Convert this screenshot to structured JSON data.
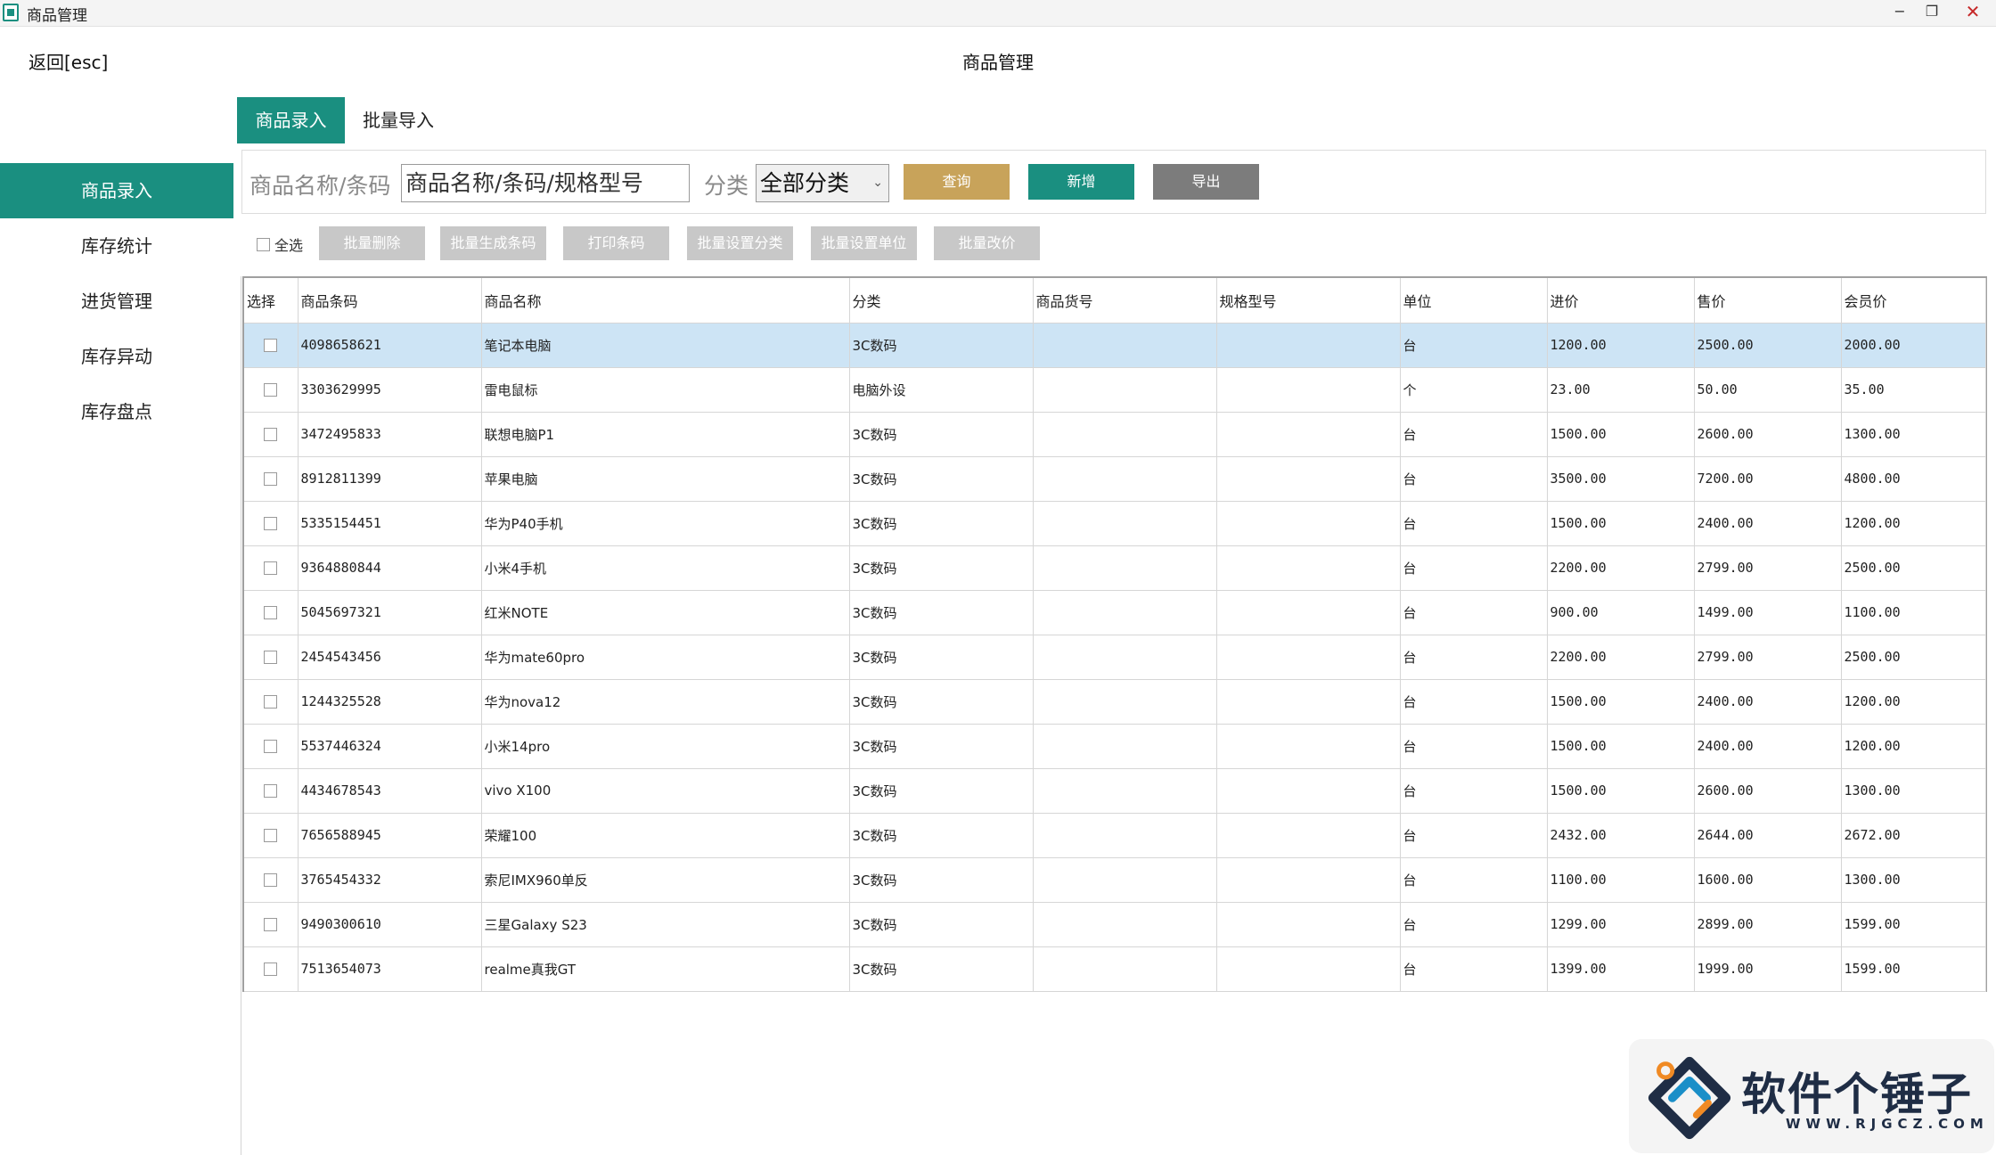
{
  "window": {
    "title": "商品管理",
    "min_icon": "minimize-icon",
    "max_icon": "restore-icon",
    "close_icon": "close-icon"
  },
  "header": {
    "back_label": "返回[esc]",
    "title": "商品管理"
  },
  "tabs": [
    {
      "label": "商品录入",
      "active": true
    },
    {
      "label": "批量导入",
      "active": false
    }
  ],
  "sidebar": {
    "items": [
      {
        "label": "商品录入",
        "active": true
      },
      {
        "label": "库存统计"
      },
      {
        "label": "进货管理"
      },
      {
        "label": "库存异动"
      },
      {
        "label": "库存盘点"
      }
    ]
  },
  "search": {
    "label": "商品名称/条码",
    "placeholder": "商品名称/条码/规格型号",
    "category_label": "分类",
    "category_value": "全部分类",
    "query_label": "查询",
    "add_label": "新增",
    "export_label": "导出"
  },
  "batch": {
    "select_all": "全选",
    "buttons": [
      "批量删除",
      "批量生成条码",
      "打印条码",
      "批量设置分类",
      "批量设置单位",
      "批量改价"
    ]
  },
  "table": {
    "columns": [
      "选择",
      "商品条码",
      "商品名称",
      "分类",
      "商品货号",
      "规格型号",
      "单位",
      "进价",
      "售价",
      "会员价"
    ],
    "rows": [
      {
        "barcode": "4098658621",
        "name": "笔记本电脑",
        "category": "3C数码",
        "sku": "",
        "spec": "",
        "unit": "台",
        "cost": "1200.00",
        "price": "2500.00",
        "member": "2000.00",
        "selected": true
      },
      {
        "barcode": "3303629995",
        "name": "雷电鼠标",
        "category": "电脑外设",
        "sku": "",
        "spec": "",
        "unit": "个",
        "cost": "23.00",
        "price": "50.00",
        "member": "35.00"
      },
      {
        "barcode": "3472495833",
        "name": "联想电脑P1",
        "category": "3C数码",
        "sku": "",
        "spec": "",
        "unit": "台",
        "cost": "1500.00",
        "price": "2600.00",
        "member": "1300.00"
      },
      {
        "barcode": "8912811399",
        "name": "苹果电脑",
        "category": "3C数码",
        "sku": "",
        "spec": "",
        "unit": "台",
        "cost": "3500.00",
        "price": "7200.00",
        "member": "4800.00"
      },
      {
        "barcode": "5335154451",
        "name": "华为P40手机",
        "category": "3C数码",
        "sku": "",
        "spec": "",
        "unit": "台",
        "cost": "1500.00",
        "price": "2400.00",
        "member": "1200.00"
      },
      {
        "barcode": "9364880844",
        "name": "小米4手机",
        "category": "3C数码",
        "sku": "",
        "spec": "",
        "unit": "台",
        "cost": "2200.00",
        "price": "2799.00",
        "member": "2500.00"
      },
      {
        "barcode": "5045697321",
        "name": "红米NOTE",
        "category": "3C数码",
        "sku": "",
        "spec": "",
        "unit": "台",
        "cost": "900.00",
        "price": "1499.00",
        "member": "1100.00"
      },
      {
        "barcode": "2454543456",
        "name": "华为mate60pro",
        "category": "3C数码",
        "sku": "",
        "spec": "",
        "unit": "台",
        "cost": "2200.00",
        "price": "2799.00",
        "member": "2500.00"
      },
      {
        "barcode": "1244325528",
        "name": "华为nova12",
        "category": "3C数码",
        "sku": "",
        "spec": "",
        "unit": "台",
        "cost": "1500.00",
        "price": "2400.00",
        "member": "1200.00"
      },
      {
        "barcode": "5537446324",
        "name": "小米14pro",
        "category": "3C数码",
        "sku": "",
        "spec": "",
        "unit": "台",
        "cost": "1500.00",
        "price": "2400.00",
        "member": "1200.00"
      },
      {
        "barcode": "4434678543",
        "name": "vivo X100",
        "category": "3C数码",
        "sku": "",
        "spec": "",
        "unit": "台",
        "cost": "1500.00",
        "price": "2600.00",
        "member": "1300.00"
      },
      {
        "barcode": "7656588945",
        "name": "荣耀100",
        "category": "3C数码",
        "sku": "",
        "spec": "",
        "unit": "台",
        "cost": "2432.00",
        "price": "2644.00",
        "member": "2672.00"
      },
      {
        "barcode": "3765454332",
        "name": "索尼IMX960单反",
        "category": "3C数码",
        "sku": "",
        "spec": "",
        "unit": "台",
        "cost": "1100.00",
        "price": "1600.00",
        "member": "1300.00"
      },
      {
        "barcode": "9490300610",
        "name": "三星Galaxy S23",
        "category": "3C数码",
        "sku": "",
        "spec": "",
        "unit": "台",
        "cost": "1299.00",
        "price": "2899.00",
        "member": "1599.00"
      },
      {
        "barcode": "7513654073",
        "name": "realme真我GT",
        "category": "3C数码",
        "sku": "",
        "spec": "",
        "unit": "台",
        "cost": "1399.00",
        "price": "1999.00",
        "member": "1599.00"
      }
    ]
  },
  "watermark": {
    "text": "软件个锤子",
    "url": "WWW.RJGCZ.COM"
  },
  "colors": {
    "accent": "#1a8f80",
    "query": "#c8a35a",
    "export": "#7c7c7c",
    "selected_row": "#cde4f5",
    "disabled": "#c8c8c8"
  }
}
